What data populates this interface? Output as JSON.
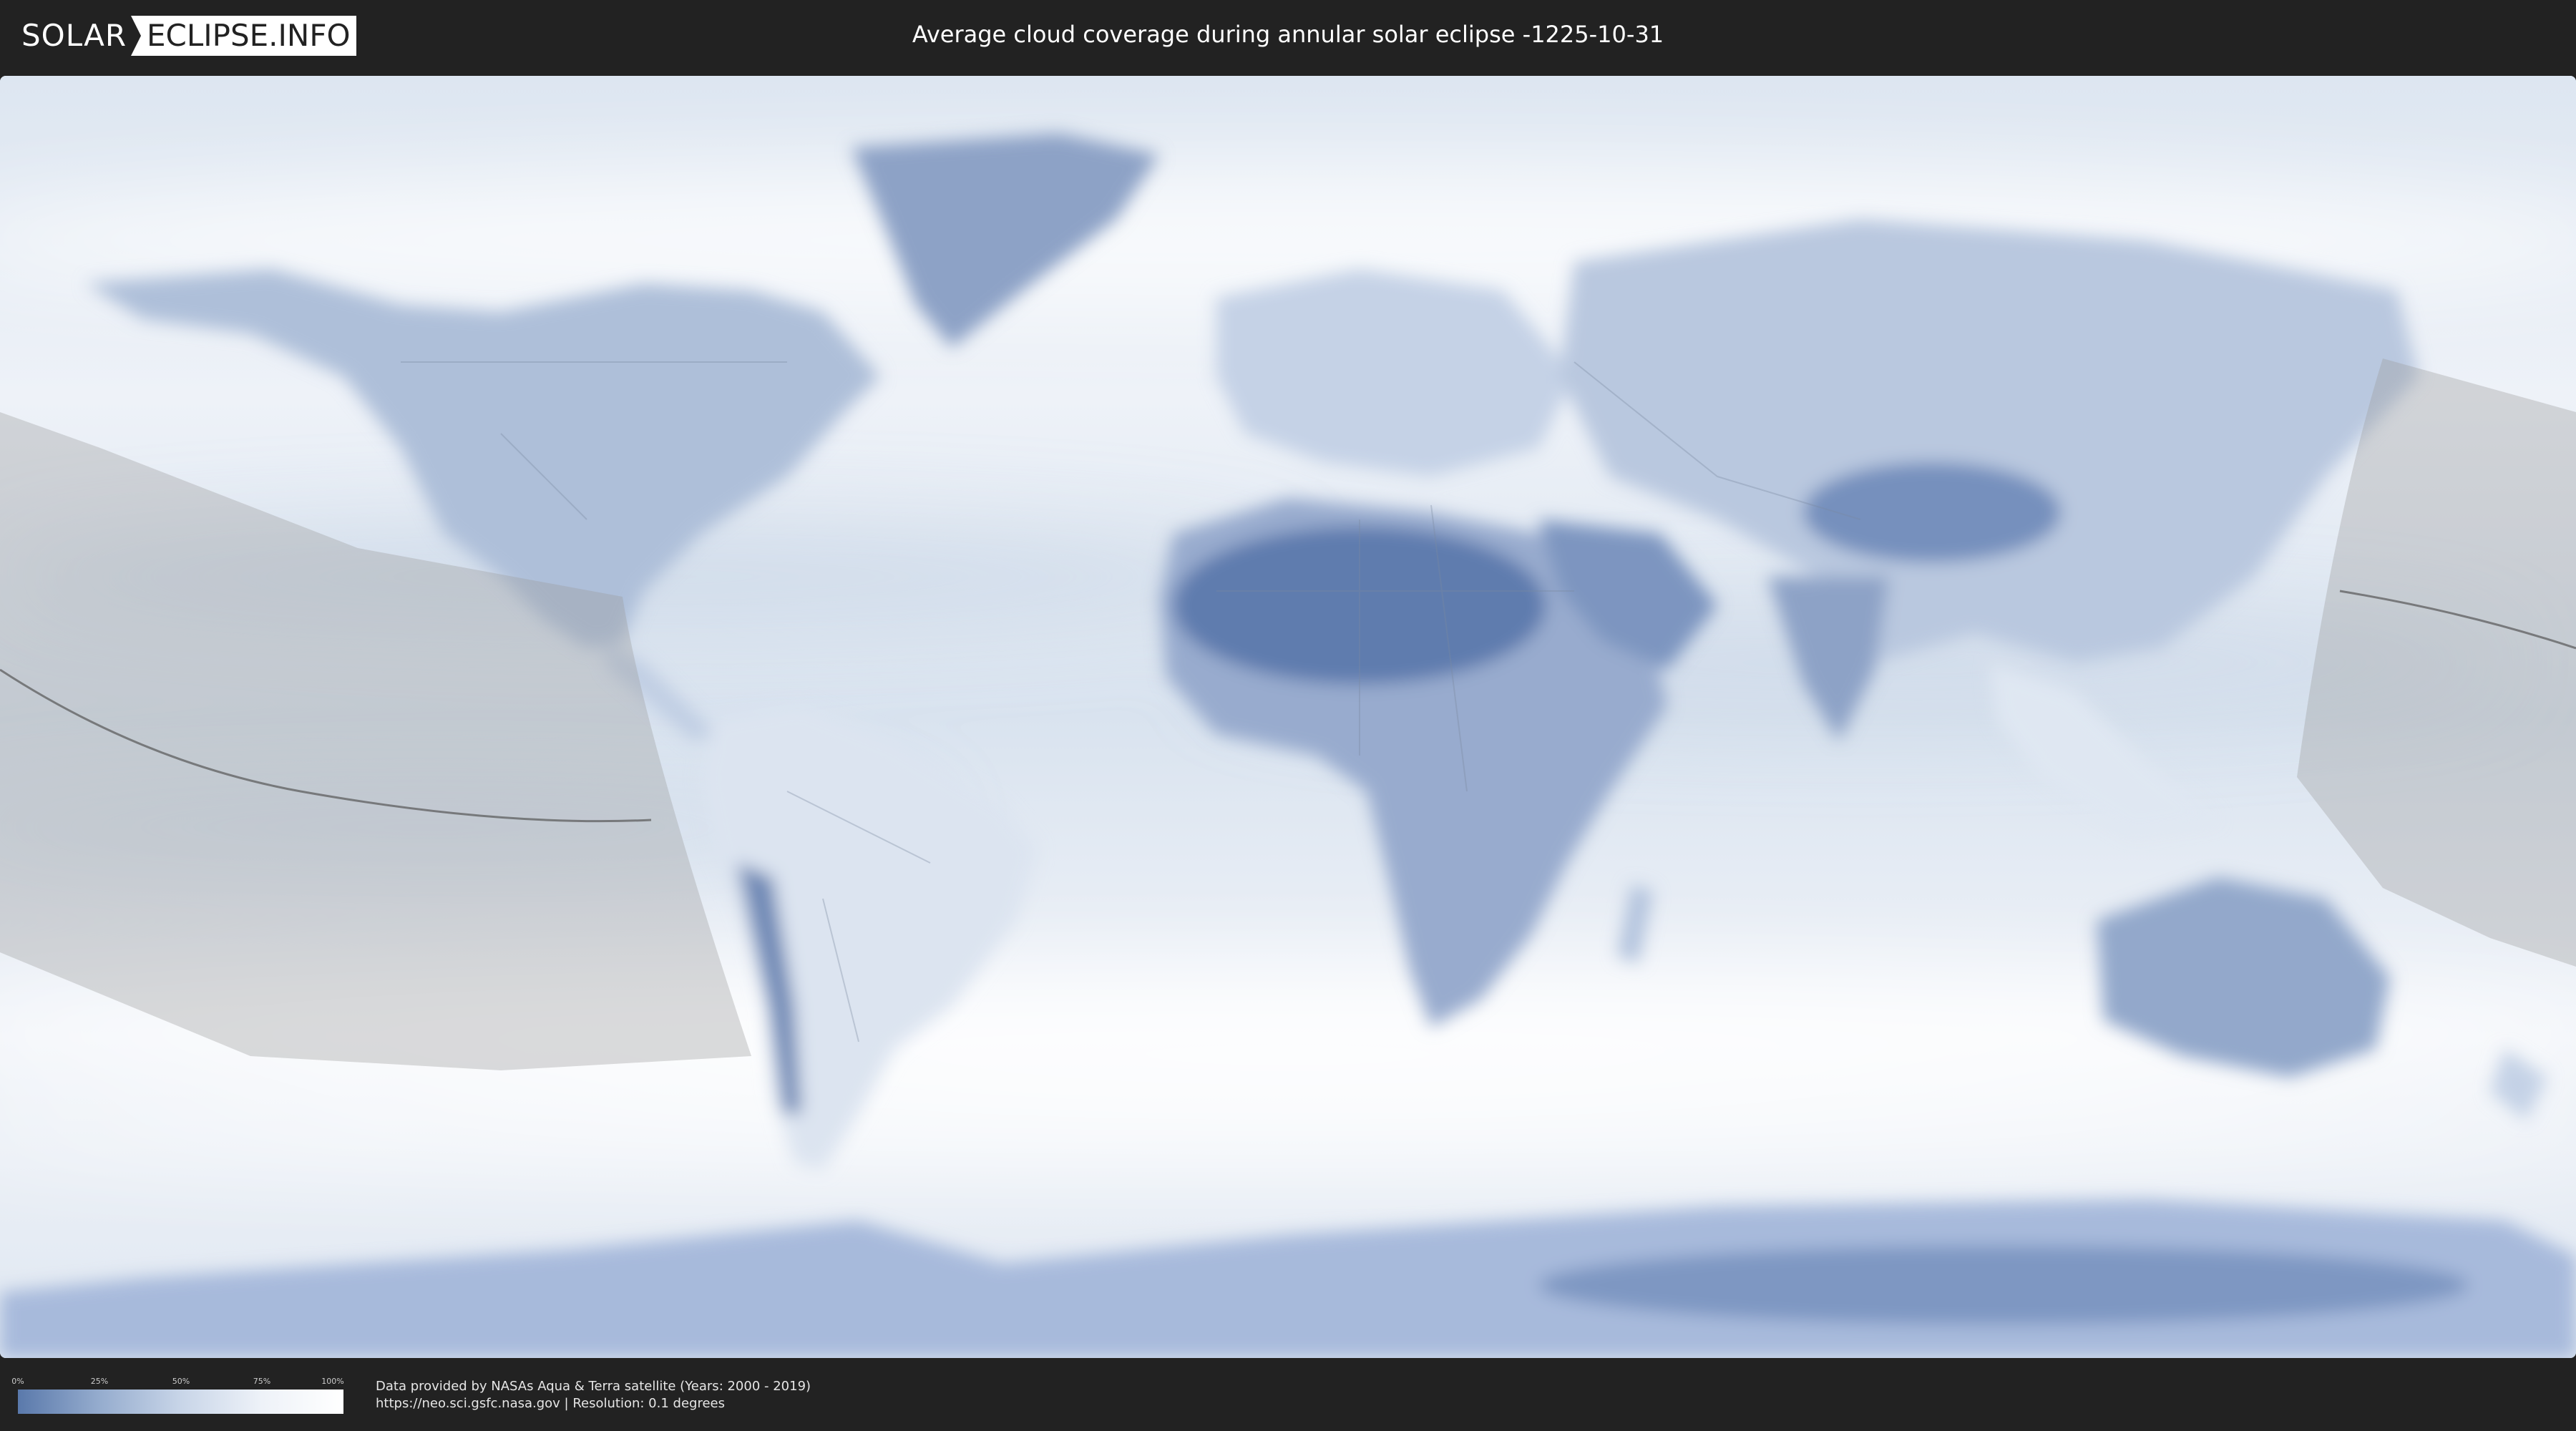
{
  "header": {
    "logo_left": "SOLAR",
    "logo_right": "ECLIPSE.INFO",
    "title": "Average cloud coverage during annular solar eclipse -1225-10-31"
  },
  "map": {
    "colors": {
      "clear": "#5a79ab",
      "cloudy": "#ffffff",
      "ocean_base": "#e8eef6",
      "eclipse_shade": "#9a9a9a",
      "central_line": "#555555",
      "borders": "#7a8aa0"
    }
  },
  "legend": {
    "scale_labels": [
      "0%",
      "25%",
      "50%",
      "75%",
      "100%"
    ],
    "scale_min_color": "#5a79ab",
    "scale_max_color": "#ffffff"
  },
  "footer": {
    "credit_line_1": "Data provided by NASAs Aqua & Terra satellite (Years: 2000 - 2019)",
    "credit_line_2": "https://neo.sci.gsfc.nasa.gov | Resolution: 0.1 degrees"
  }
}
